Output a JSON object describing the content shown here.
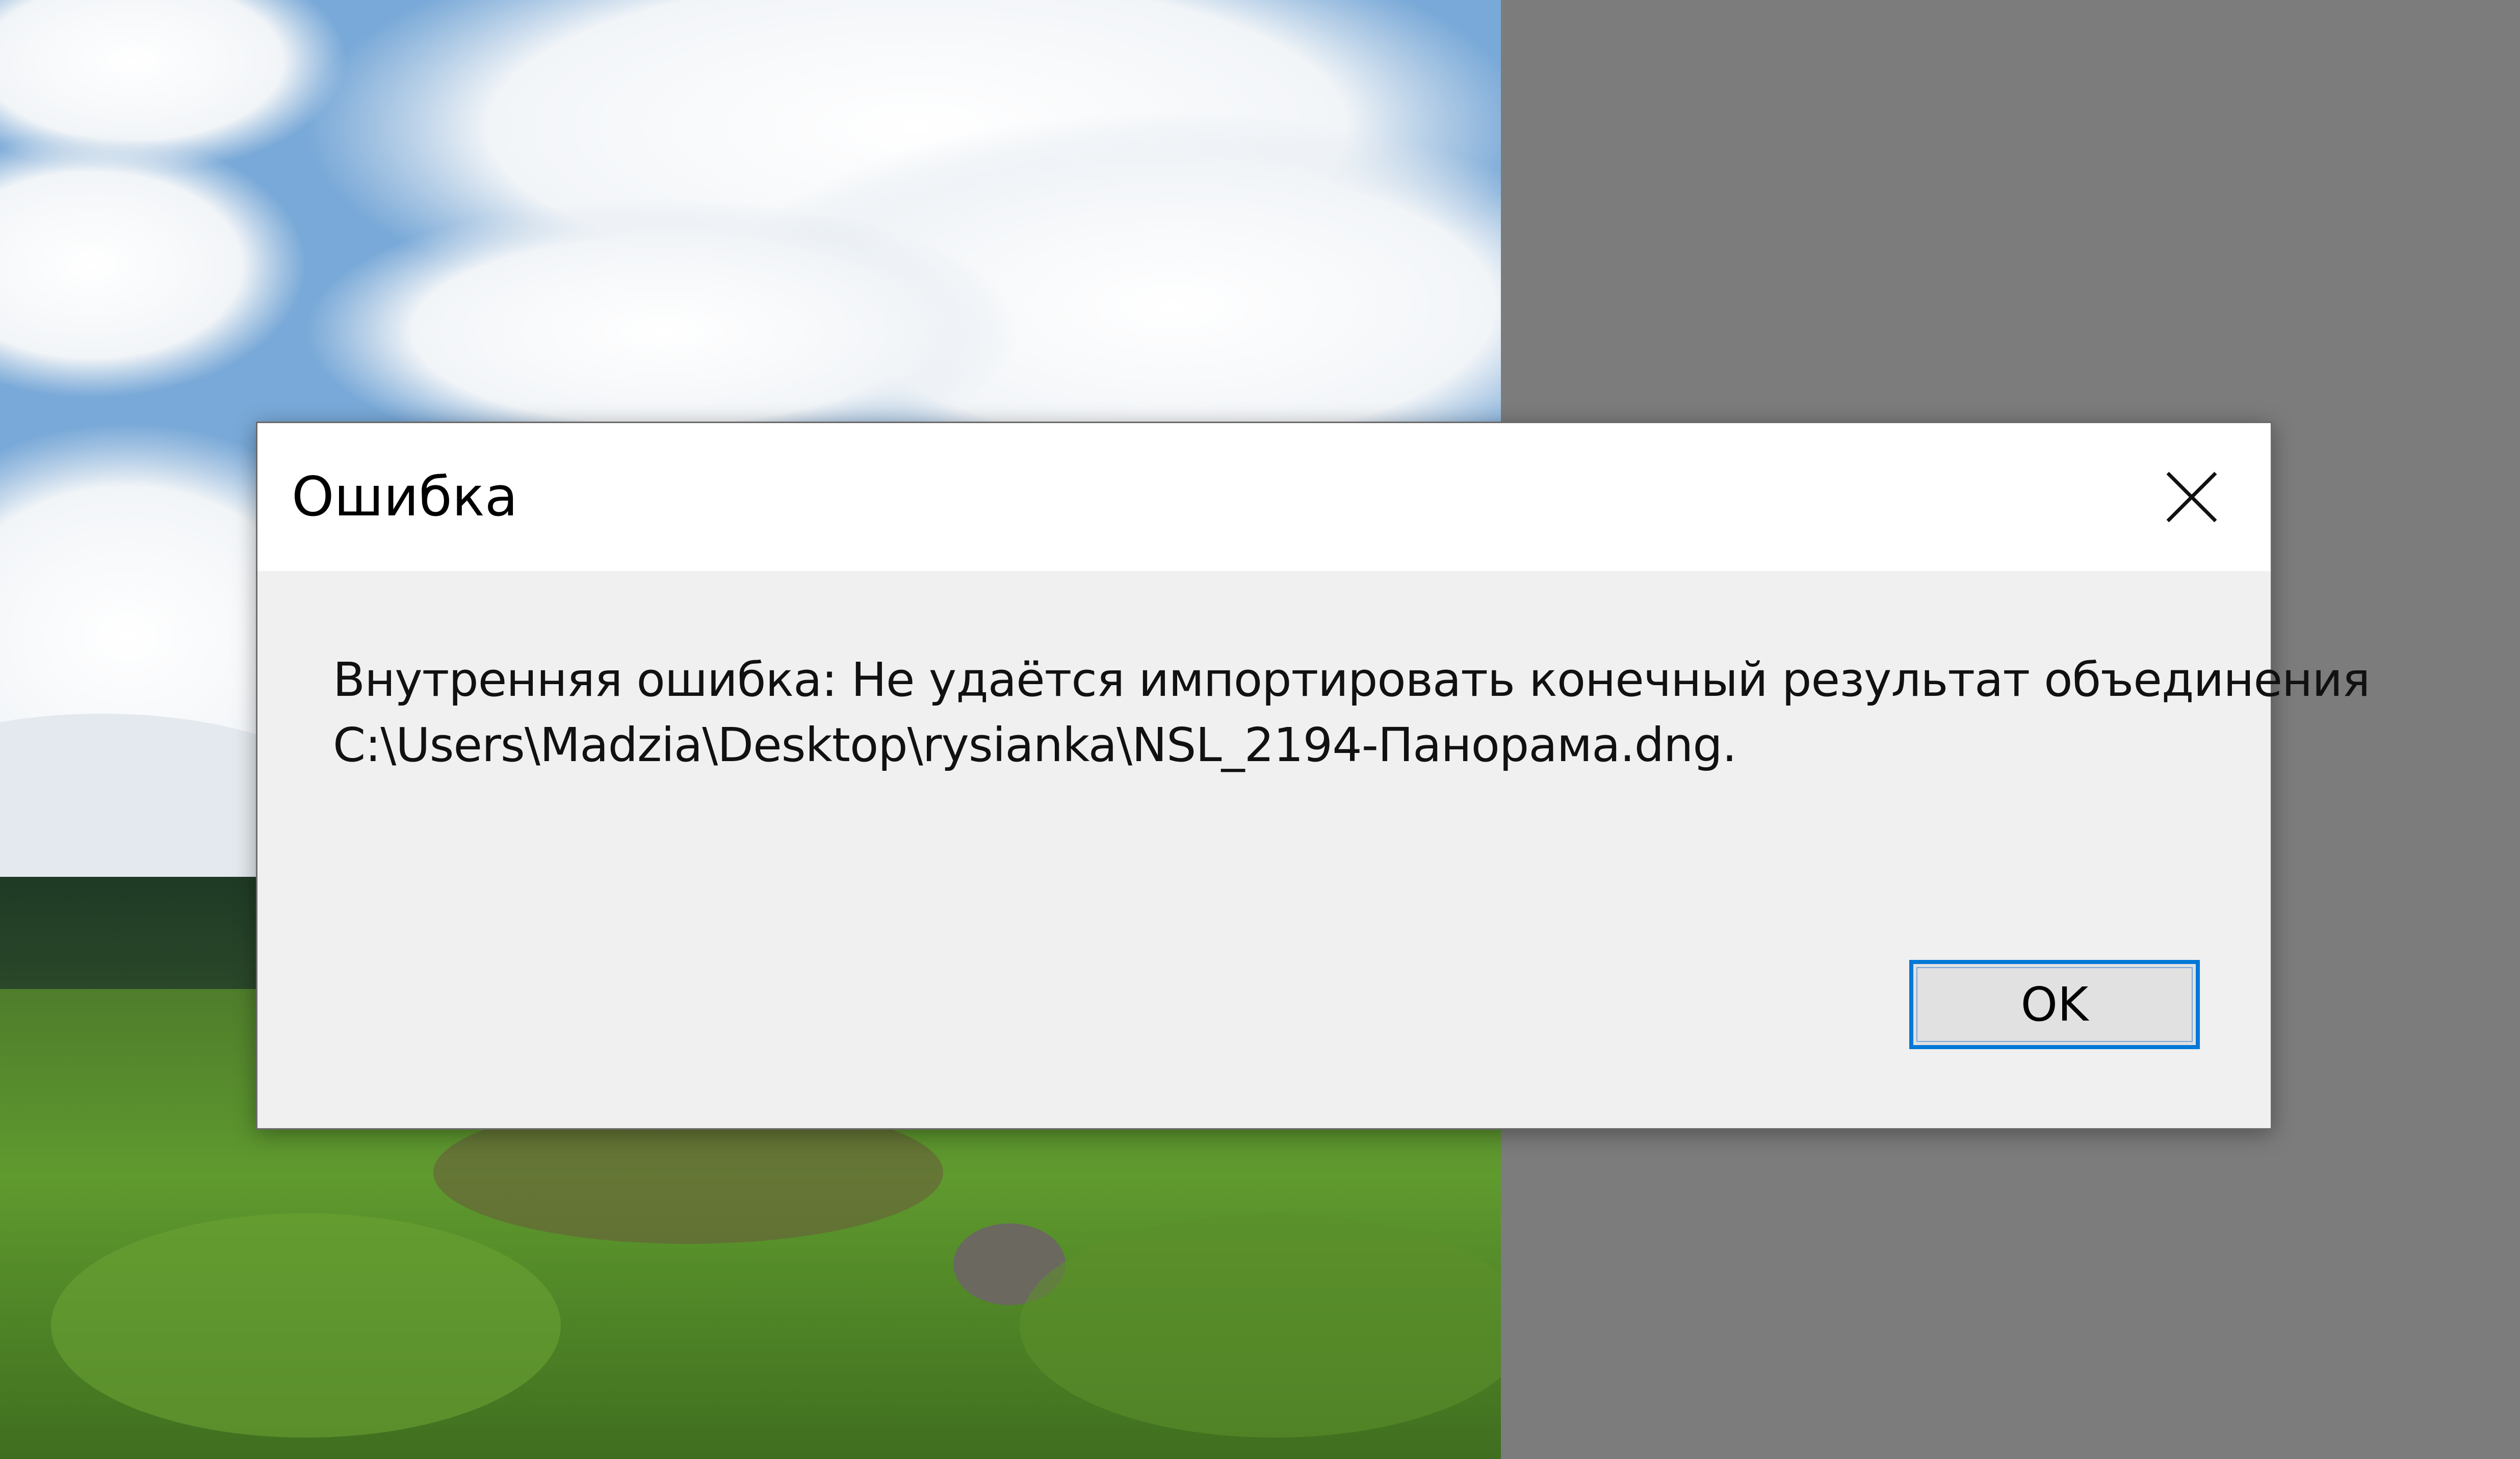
{
  "dialog": {
    "title": "Ошибка",
    "message_line1": "Внутренняя ошибка: Не удаётся импортировать конечный результат объединения",
    "message_line2": "C:\\Users\\Madzia\\Desktop\\rysianka\\NSL_2194-Панорама.dng.",
    "ok_label": "OK",
    "close_icon": "close-icon"
  },
  "colors": {
    "workspace_gray": "#7c7c7c",
    "dialog_body": "#f0f0f0",
    "titlebar": "#ffffff",
    "button_focus_border": "#0078d7",
    "button_face": "#e1e1e1"
  }
}
